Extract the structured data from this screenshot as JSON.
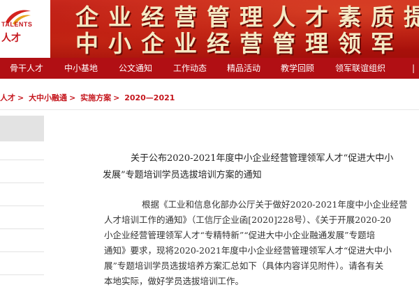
{
  "banner": {
    "logo_small": "TALENTS",
    "logo_cn": "人才",
    "slogan_line1": "企业经营管理人才素质提升",
    "slogan_line2": "中小企业经营管理领军"
  },
  "nav": {
    "items": [
      "骨干人才",
      "中小基地",
      "公文通知",
      "工作动态",
      "精品活动",
      "教学回顾",
      "领军联谊组织"
    ]
  },
  "breadcrumb": {
    "items": [
      "人才",
      "大中小融通",
      "实施方案",
      "2020—2021"
    ]
  },
  "article": {
    "title_line1": "关于公布2020-2021年度中小企业经营管理领军人才“促进大中小",
    "title_line2": "发展”专题培训学员选拔培训方案的通知",
    "body": [
      "根据《工业和信息化部办公厅关于做好2020-2021年度中小企业经营",
      "人才培训工作的通知》（工信厅企业函[2020]228号）、《关于开展2020-20",
      "小企业经营管理领军人才“专精特新”“促进大中小企业融通发展”专题培",
      "通知》要求，现将2020-2021年度中小企业经营管理领军人才“促进大中小",
      "展”专题培训学员选拔培养方案汇总如下（具体内容详见附件）。请各有关",
      "本地实际，做好学员选拔培训工作。"
    ]
  },
  "colors": {
    "brand_red": "#b10f14",
    "banner_text": "#f5e9c4",
    "crumb_red": "#c5161d"
  }
}
